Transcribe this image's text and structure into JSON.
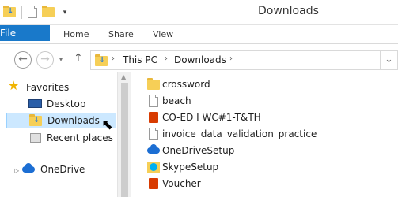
{
  "window": {
    "title": "Downloads"
  },
  "ribbon": {
    "file": "File",
    "home": "Home",
    "share": "Share",
    "view": "View"
  },
  "address": {
    "crumbs": [
      "This PC",
      "Downloads"
    ]
  },
  "navpane": {
    "favorites": "Favorites",
    "items": [
      {
        "label": "Desktop",
        "icon": "desktop-icon"
      },
      {
        "label": "Downloads",
        "icon": "downloads-folder-icon",
        "selected": true
      },
      {
        "label": "Recent places",
        "icon": "recent-places-icon"
      }
    ],
    "onedrive": "OneDrive"
  },
  "files": [
    {
      "name": "crossword",
      "icon": "folder-icon"
    },
    {
      "name": "beach",
      "icon": "document-icon"
    },
    {
      "name": "CO-ED I WC#1-T&TH",
      "icon": "office-icon"
    },
    {
      "name": "invoice_data_validation_practice",
      "icon": "document-icon"
    },
    {
      "name": "OneDriveSetup",
      "icon": "onedrive-icon"
    },
    {
      "name": "SkypeSetup",
      "icon": "skype-icon"
    },
    {
      "name": "Voucher",
      "icon": "office-icon"
    }
  ],
  "colors": {
    "accent": "#1979ca",
    "selection": "#cce8ff",
    "folder": "#f6cf57"
  }
}
